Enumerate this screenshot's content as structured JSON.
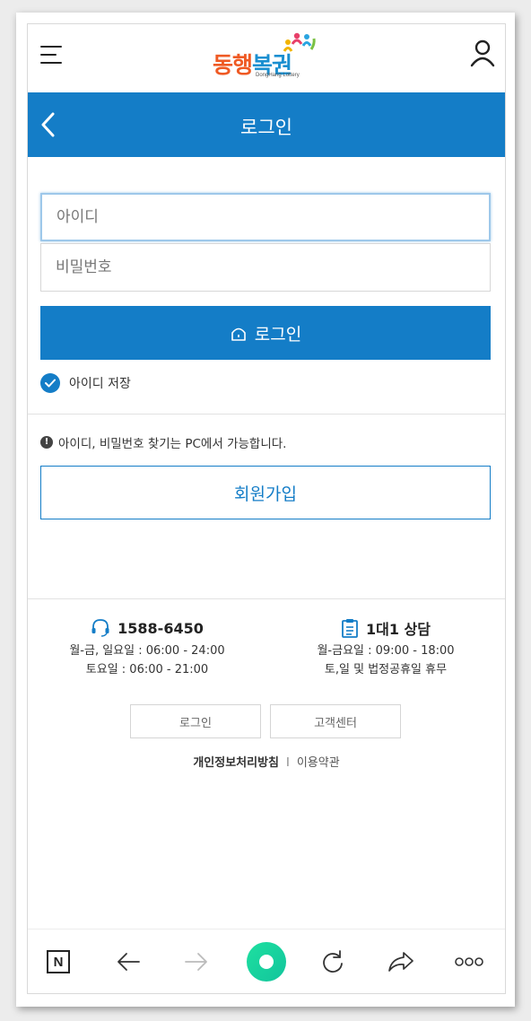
{
  "header": {
    "logo_main_1": "동행",
    "logo_main_2": "복권",
    "logo_sub": "DongHang Lottery"
  },
  "title_bar": {
    "title": "로그인"
  },
  "form": {
    "id_placeholder": "아이디",
    "password_placeholder": "비밀번호",
    "login_label": "로그인",
    "remember_label": "아이디 저장",
    "remember_checked": true
  },
  "notice": {
    "icon": "!",
    "text": "아이디, 비밀번호 찾기는 PC에서 가능합니다."
  },
  "join": {
    "label": "회원가입"
  },
  "contacts": {
    "phone": {
      "number": "1588-6450",
      "line1": "월-금, 일요일 : 06:00 - 24:00",
      "line2": "토요일 : 06:00 - 21:00"
    },
    "counsel": {
      "title": "1대1 상담",
      "line1": "월-금요일 : 09:00 - 18:00",
      "line2": "토,일 및 법정공휴일 휴무"
    }
  },
  "footer": {
    "login_button": "로그인",
    "support_button": "고객센터",
    "privacy_link": "개인정보처리방침",
    "separator": "I",
    "terms_link": "이용약관"
  },
  "browser_toolbar": {
    "home_letter": "N",
    "icons": [
      "naver-home-icon",
      "arrow-left-icon",
      "arrow-right-icon",
      "green-dot-icon",
      "refresh-icon",
      "share-icon",
      "more-icon"
    ]
  },
  "colors": {
    "primary": "#147dc7",
    "logo_orange": "#ef5a24",
    "logo_blue": "#1a8fd0",
    "green": "#12c49c"
  }
}
